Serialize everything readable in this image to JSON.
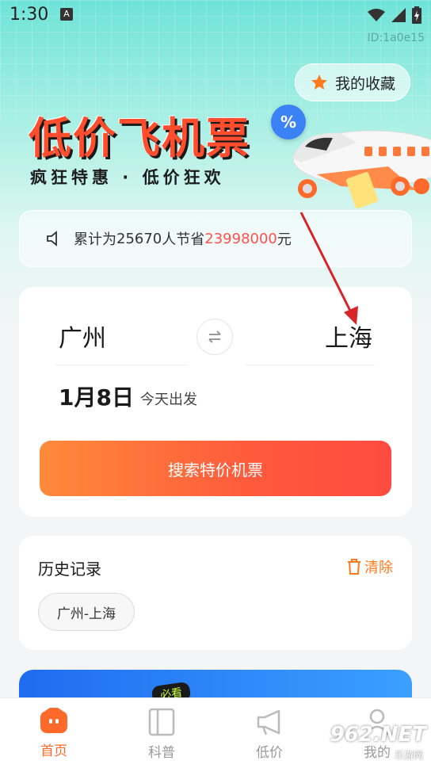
{
  "status_bar": {
    "time": "1:30",
    "notification_icon": "A"
  },
  "device_id": "ID:1a0e15",
  "favorites_button": {
    "label": "我的收藏",
    "icon": "star-icon"
  },
  "banner": {
    "title": "低价飞机票",
    "subtitle": "疯狂特惠 · 低价狂欢",
    "badge": "%"
  },
  "notice": {
    "prefix": "累计为",
    "people_count": "25670",
    "middle": "人节省",
    "amount": "23998000",
    "suffix": "元"
  },
  "search_card": {
    "from_city": "广州",
    "to_city": "上海",
    "date": "1月8日",
    "date_note": "今天出发",
    "search_button": "搜索特价机票"
  },
  "history": {
    "title": "历史记录",
    "clear_label": "清除",
    "items": [
      "广州-上海"
    ]
  },
  "promo": {
    "badge": "必看"
  },
  "tabs": [
    {
      "label": "首页",
      "active": true
    },
    {
      "label": "科普",
      "active": false
    },
    {
      "label": "低价",
      "active": false
    },
    {
      "label": "我的",
      "active": false
    }
  ],
  "watermark": {
    "main": "962.NET",
    "sub": "乐游网"
  },
  "colors": {
    "accent": "#ff6a2a",
    "highlight": "#ff4f4f",
    "teal": "#6fe3d8"
  }
}
